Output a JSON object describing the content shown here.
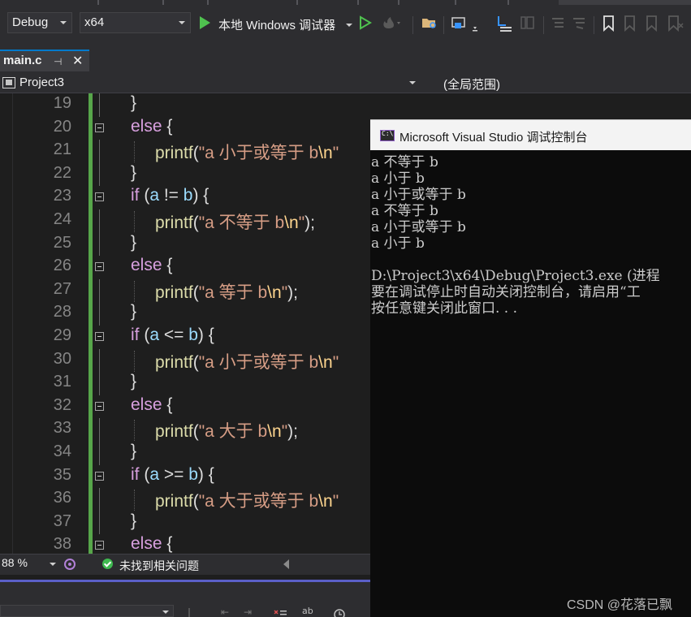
{
  "toolbar": {
    "config_value": "Debug",
    "platform_value": "x64",
    "run_label": "本地 Windows 调试器"
  },
  "tabs": [
    {
      "label": "main.c"
    }
  ],
  "navbar": {
    "project": "Project3",
    "scope": "(全局范围)"
  },
  "editor": {
    "lines": [
      {
        "num": "19",
        "code": "}"
      },
      {
        "num": "20",
        "code": "else {"
      },
      {
        "num": "21",
        "code": "printf(\"a 小于或等于 b\\n\""
      },
      {
        "num": "22",
        "code": "}"
      },
      {
        "num": "23",
        "code": "if (a != b) {"
      },
      {
        "num": "24",
        "code": "printf(\"a 不等于 b\\n\");"
      },
      {
        "num": "25",
        "code": "}"
      },
      {
        "num": "26",
        "code": "else {"
      },
      {
        "num": "27",
        "code": "printf(\"a 等于 b\\n\");"
      },
      {
        "num": "28",
        "code": "}"
      },
      {
        "num": "29",
        "code": "if (a <= b) {"
      },
      {
        "num": "30",
        "code": "printf(\"a 小于或等于 b\\n\""
      },
      {
        "num": "31",
        "code": "}"
      },
      {
        "num": "32",
        "code": "else {"
      },
      {
        "num": "33",
        "code": "printf(\"a 大于 b\\n\");"
      },
      {
        "num": "34",
        "code": "}"
      },
      {
        "num": "35",
        "code": "if (a >= b) {"
      },
      {
        "num": "36",
        "code": "printf(\"a 大于或等于 b\\n\""
      },
      {
        "num": "37",
        "code": "}"
      },
      {
        "num": "38",
        "code": "else {"
      }
    ]
  },
  "status": {
    "zoom": "88 %",
    "issues": "未找到相关问题"
  },
  "console": {
    "title": "Microsoft Visual Studio 调试控制台",
    "lines": [
      "a 不等于 b",
      "a 小于 b",
      "a 小于或等于 b",
      "a 不等于 b",
      "a 小于或等于 b",
      "a 小于 b",
      "",
      "D:\\Project3\\x64\\Debug\\Project3.exe (进程",
      "要在调试停止时自动关闭控制台，请启用“工",
      "按任意键关闭此窗口. . ."
    ]
  },
  "watermark": "CSDN @花落已飘",
  "colors": {
    "accent": "#007acc",
    "change_bar": "#57a64a",
    "keyword": "#d8a0df",
    "string": "#d69d85",
    "escape": "#ffd68f",
    "variable": "#9cdcfe"
  }
}
